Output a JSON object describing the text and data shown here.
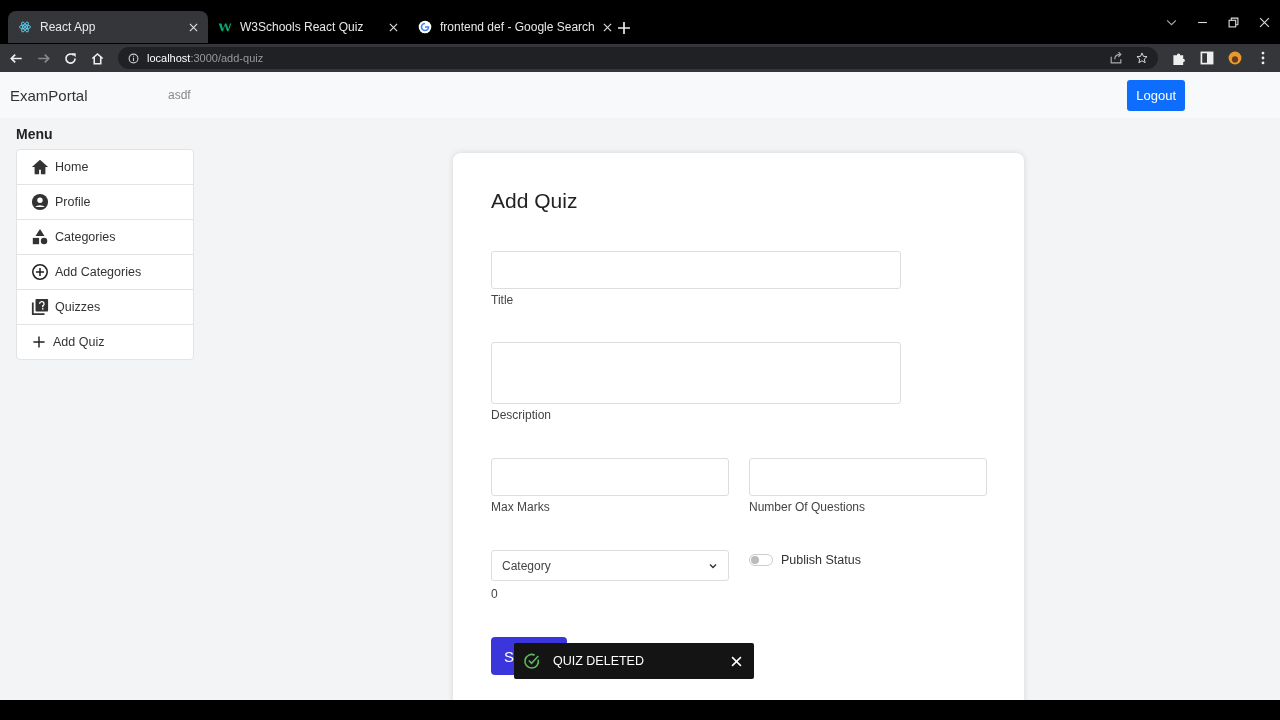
{
  "browser": {
    "tabs": [
      {
        "label": "React App",
        "selected": true,
        "kind": "react"
      },
      {
        "label": "W3Schools React Quiz",
        "selected": false,
        "kind": "w3"
      },
      {
        "label": "frontend def - Google Search",
        "selected": false,
        "kind": "google"
      }
    ],
    "address": {
      "host": "localhost",
      "path": ":3000/add-quiz"
    }
  },
  "navbar": {
    "brand": "ExamPortal",
    "user": "asdf",
    "logout": "Logout"
  },
  "sidebar": {
    "title": "Menu",
    "items": [
      {
        "label": "Home",
        "kind": "home"
      },
      {
        "label": "Profile",
        "kind": "profile"
      },
      {
        "label": "Categories",
        "kind": "shapes"
      },
      {
        "label": "Add Categories",
        "kind": "add-circle"
      },
      {
        "label": "Quizzes",
        "kind": "quiz"
      },
      {
        "label": "Add Quiz",
        "kind": "plus"
      }
    ]
  },
  "form": {
    "title": "Add Quiz",
    "fields": [
      {
        "label": "Title",
        "kind": "text"
      },
      {
        "label": "Description",
        "kind": "textarea"
      }
    ],
    "pair": [
      {
        "label": "Max Marks"
      },
      {
        "label": "Number Of Questions"
      }
    ],
    "category": {
      "value": "Category",
      "note": "0"
    },
    "publish": {
      "label": "Publish Status",
      "on": false
    },
    "submit": "S"
  },
  "toast": {
    "message": "QUIZ DELETED"
  }
}
